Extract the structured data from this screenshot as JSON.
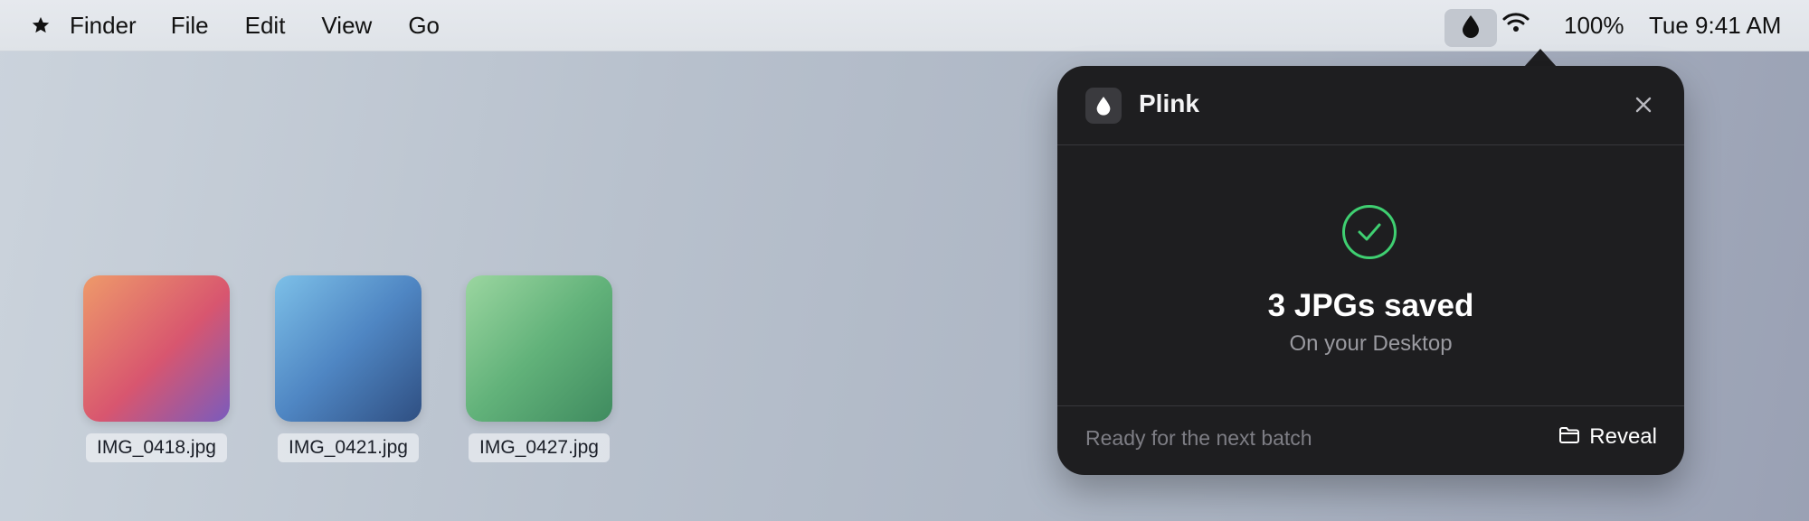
{
  "menubar": {
    "apple_icon": "star-icon",
    "app_name": "Finder",
    "menus": [
      "File",
      "Edit",
      "View",
      "Go"
    ],
    "battery": "100%",
    "clock": "Tue 9:41 AM"
  },
  "desktop": {
    "files": [
      {
        "name": "IMG_0418.jpg"
      },
      {
        "name": "IMG_0421.jpg"
      },
      {
        "name": "IMG_0427.jpg"
      }
    ]
  },
  "popover": {
    "app_title": "Plink",
    "headline": "3 JPGs saved",
    "subline": "On your Desktop",
    "footer_status": "Ready for the next batch",
    "reveal_label": "Reveal",
    "accent_color": "#3fcf71"
  }
}
